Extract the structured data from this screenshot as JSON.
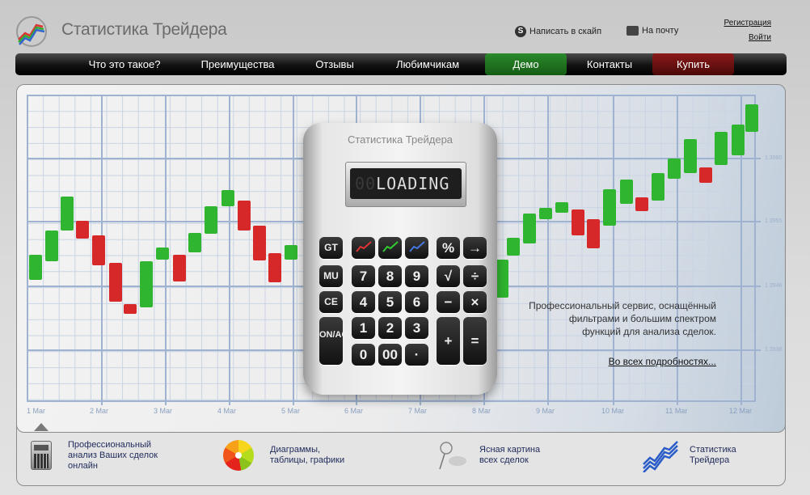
{
  "header": {
    "logo_text": "Статистика Трейдера",
    "skype_label": "Написать в скайп",
    "mail_label": "На почту",
    "register_label": "Регистрация",
    "login_label": "Войти"
  },
  "nav": {
    "items": [
      {
        "label": "Что это такое?"
      },
      {
        "label": "Преимущества"
      },
      {
        "label": "Отзывы"
      },
      {
        "label": "Любимчикам"
      },
      {
        "label": "Демо"
      },
      {
        "label": "Контакты"
      },
      {
        "label": "Купить"
      }
    ],
    "demo_color": "#1f7a1f",
    "buy_color": "#6e1010"
  },
  "hero": {
    "calculator": {
      "brand": "Статистика Трейдера",
      "display": "LOADING",
      "display_ghost": "00",
      "keys": [
        "GT",
        "",
        "",
        "",
        "%",
        "→",
        "MU",
        "7",
        "8",
        "9",
        "√",
        "÷",
        "CE",
        "4",
        "5",
        "6",
        "−",
        "×",
        "ON/AC",
        "1",
        "2",
        "3",
        "+",
        "=",
        "0",
        "00",
        "·"
      ]
    },
    "chart": {
      "x_labels": [
        "1 Mar",
        "2 Mar",
        "3 Mar",
        "4 Mar",
        "5 Mar",
        "6 Mar",
        "7 Mar",
        "8 Mar",
        "9 Mar",
        "10 Mar",
        "11 Mar",
        "12 Mar"
      ],
      "y_labels": [
        "1.3980",
        "1.3955",
        "1.3946",
        "1.3938"
      ],
      "up_color": "#2fb52f",
      "down_color": "#d62828"
    },
    "description": [
      "Профессиональный сервис, оснащённый",
      "фильтрами и большим спектром",
      "функций для анализа сделок."
    ],
    "more_link": "Во всех подробностях..."
  },
  "features": [
    {
      "icon": "calculator-icon",
      "lines": [
        "Профессиональный",
        "анализ Ваших сделок",
        "онлайн"
      ]
    },
    {
      "icon": "pie-chart-icon",
      "lines": [
        "Диаграммы,",
        "таблицы, графики"
      ]
    },
    {
      "icon": "magnifier-icon",
      "lines": [
        "Ясная картина",
        "всех сделок"
      ]
    },
    {
      "icon": "trader-logo-icon",
      "lines": [
        "Статистика",
        "Трейдера"
      ]
    }
  ]
}
